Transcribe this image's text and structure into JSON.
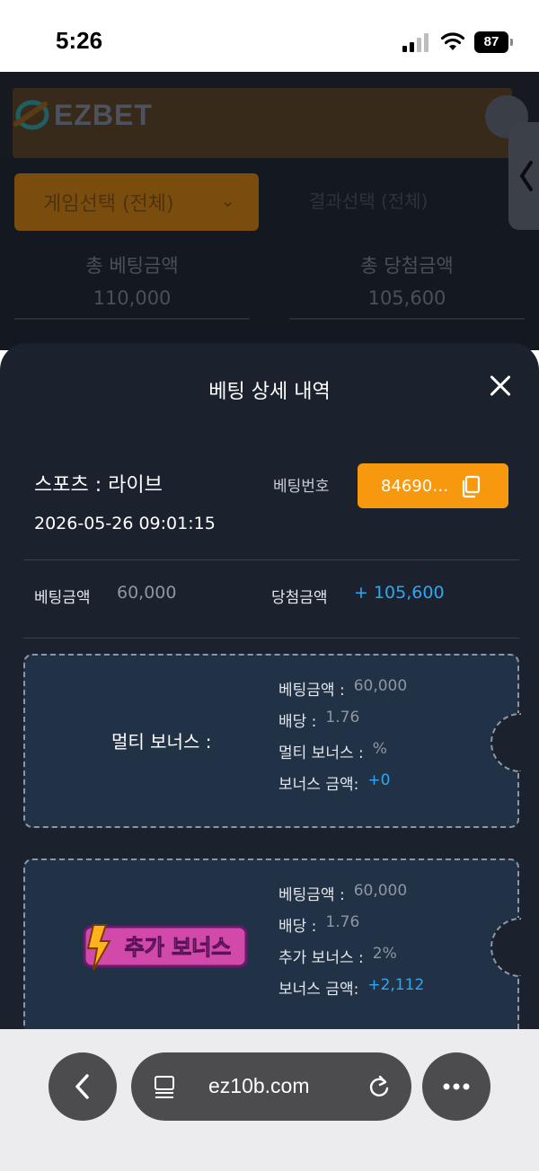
{
  "status_bar": {
    "time": "5:26",
    "battery": "87"
  },
  "background_site": {
    "logo_text": "EZBET",
    "game_select": "게임선택 (전체)",
    "result_select": "결과선택 (전체)",
    "total_bet_label": "총 베팅금액",
    "total_bet_value": "110,000",
    "total_win_label": "총 당첨금액",
    "total_win_value": "105,600"
  },
  "sheet": {
    "title": "베팅 상세 내역",
    "sport_type": "스포츠 : 라이브",
    "datetime": "2026-05-26 09:01:15",
    "bet_no_label": "베팅번호",
    "bet_no_value": "84690…",
    "bet_amount_label": "베팅금액",
    "bet_amount_value": "60,000",
    "win_amount_label": "당첨금액",
    "win_amount_value": "+ 105,600"
  },
  "multi_bonus": {
    "title": "멀티 보너스 :",
    "rows": [
      {
        "key": "베팅금액 :",
        "value": "60,000"
      },
      {
        "key": "배당 :",
        "value": "1.76"
      },
      {
        "key": "멀티 보너스 :",
        "value": "%"
      },
      {
        "key": "보너스 금액:",
        "value": "+0"
      }
    ]
  },
  "extra_bonus": {
    "badge_text": "추가 보너스",
    "rows": [
      {
        "key": "베팅금액 :",
        "value": "60,000"
      },
      {
        "key": "배당 :",
        "value": "1.76"
      },
      {
        "key": "추가 보너스 :",
        "value": "2%"
      },
      {
        "key": "보너스 금액:",
        "value": "+2,112"
      }
    ]
  },
  "browser": {
    "url": "ez10b.com"
  },
  "colors": {
    "accent_orange": "#f7990e",
    "value_blue": "#2ea7f2",
    "sheet_bg": "#1b222d"
  }
}
